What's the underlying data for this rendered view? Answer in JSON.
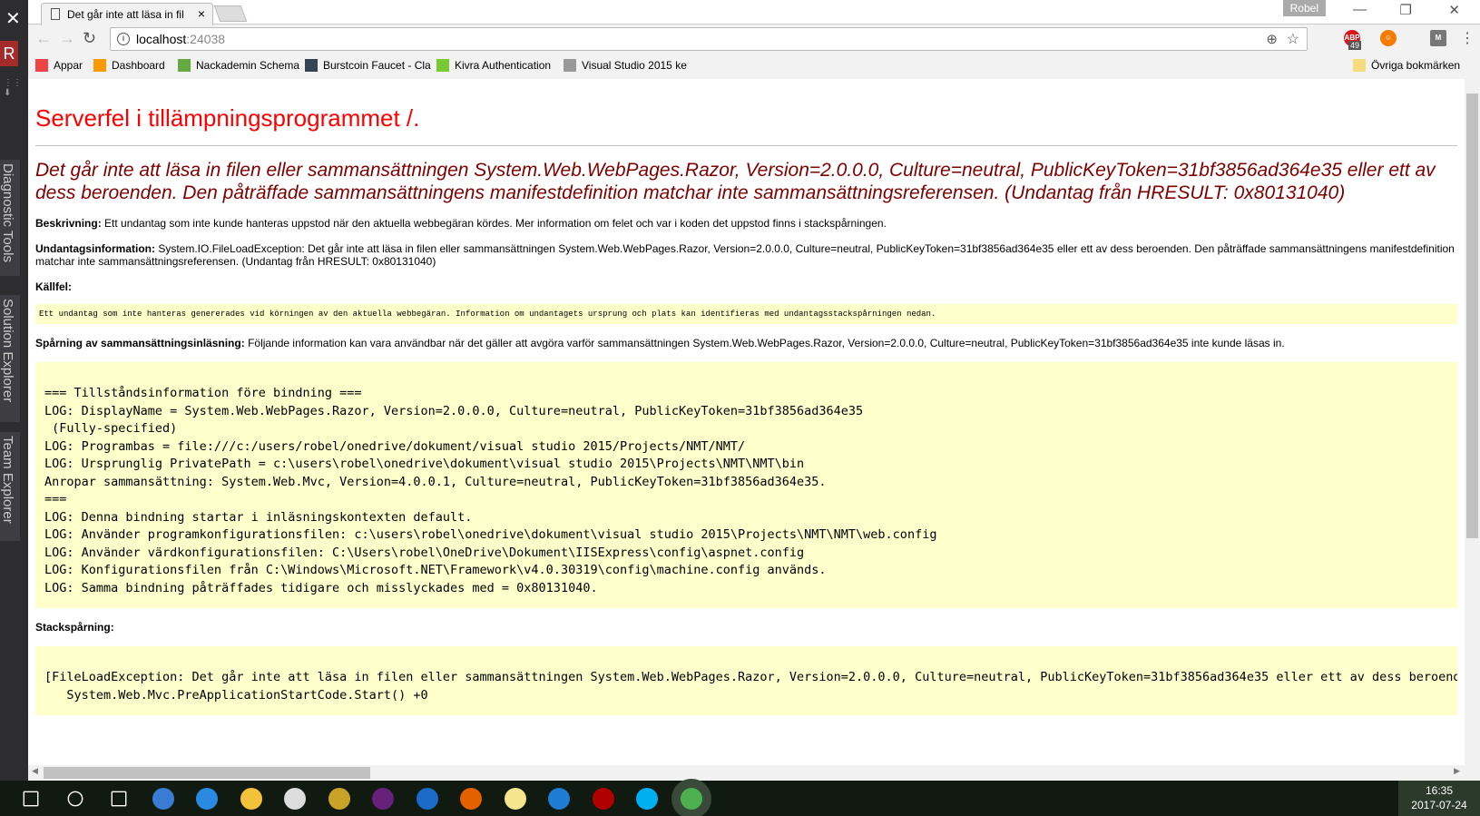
{
  "vs_sidebar": {
    "avatar_letter": "R",
    "panels": [
      "Diagnostic Tools",
      "Solution Explorer",
      "Team Explorer"
    ]
  },
  "browser": {
    "tab_title": "Det går inte att läsa in fil",
    "user": "Robel",
    "url_host": "localhost",
    "url_port": ":24038",
    "abp_badge": "49",
    "bookmarks": [
      {
        "label": "Appar",
        "icon": "apps-grid-icon",
        "color": "#e44"
      },
      {
        "label": "Dashboard",
        "icon": "moodle-icon",
        "color": "#f90"
      },
      {
        "label": "Nackademin Schema",
        "icon": "cupcake-icon",
        "color": "#6a4"
      },
      {
        "label": "Burstcoin Faucet - Cla",
        "icon": "burstcoin-icon",
        "color": "#345"
      },
      {
        "label": "Kivra Authentication",
        "icon": "kivra-icon",
        "color": "#7c3"
      },
      {
        "label": "Visual Studio 2015 ke",
        "icon": "document-icon",
        "color": "#999"
      }
    ],
    "other_bookmarks": "Övriga bokmärken"
  },
  "page": {
    "title": "Serverfel i tillämpningsprogrammet /.",
    "error_heading": "Det går inte att läsa in filen eller sammansättningen System.Web.WebPages.Razor, Version=2.0.0.0, Culture=neutral, PublicKeyToken=31bf3856ad364e35 eller ett av dess beroenden. Den påträffade sammansättningens manifestdefinition matchar inte sammansättningsreferensen. (Undantag från HRESULT: 0x80131040)",
    "description_label": "Beskrivning:",
    "description": "Ett undantag som inte kunde hanteras uppstod när den aktuella webbegäran kördes. Mer information om felet och var i koden det uppstod finns i stackspårningen.",
    "exception_label": "Undantagsinformation:",
    "exception": "System.IO.FileLoadException: Det går inte att läsa in filen eller sammansättningen System.Web.WebPages.Razor, Version=2.0.0.0, Culture=neutral, PublicKeyToken=31bf3856ad364e35 eller ett av dess beroenden. Den påträffade sammansättningens manifestdefinition matchar inte sammansättningsreferensen. (Undantag från HRESULT: 0x80131040)",
    "source_label": "Källfel:",
    "source_text": "Ett undantag som inte hanteras genererades vid körningen av den aktuella webbegäran. Information om undantagets ursprung och plats kan identifieras med undantagsstackspårningen nedan.",
    "trace_label": "Spårning av sammansättningsinläsning:",
    "trace_text": "Följande information kan vara användbar när det gäller att avgöra varför sammansättningen System.Web.WebPages.Razor, Version=2.0.0.0, Culture=neutral, PublicKeyToken=31bf3856ad364e35 inte kunde läsas in.",
    "log": "=== Tillståndsinformation före bindning ===\nLOG: DisplayName = System.Web.WebPages.Razor, Version=2.0.0.0, Culture=neutral, PublicKeyToken=31bf3856ad364e35\n (Fully-specified)\nLOG: Programbas = file:///c:/users/robel/onedrive/dokument/visual studio 2015/Projects/NMT/NMT/\nLOG: Ursprunglig PrivatePath = c:\\users\\robel\\onedrive\\dokument\\visual studio 2015\\Projects\\NMT\\NMT\\bin\nAnropar sammansättning: System.Web.Mvc, Version=4.0.0.1, Culture=neutral, PublicKeyToken=31bf3856ad364e35.\n===\nLOG: Denna bindning startar i inläsningskontexten default.\nLOG: Använder programkonfigurationsfilen: c:\\users\\robel\\onedrive\\dokument\\visual studio 2015\\Projects\\NMT\\NMT\\web.config\nLOG: Använder värdkonfigurationsfilen: C:\\Users\\robel\\OneDrive\\Dokument\\IISExpress\\config\\aspnet.config\nLOG: Konfigurationsfilen från C:\\Windows\\Microsoft.NET\\Framework\\v4.0.30319\\config\\machine.config används.\nLOG: Samma bindning påträffades tidigare och misslyckades med = 0x80131040.",
    "stack_label": "Stackspårning:",
    "stack": "[FileLoadException: Det går inte att läsa in filen eller sammansättningen System.Web.WebPages.Razor, Version=2.0.0.0, Culture=neutral, PublicKeyToken=31bf3856ad364e35 eller ett av dess beroenden. Den påträffade sammansättningens manifestdefinition matchar inte sammansättningsreferensen.\n   System.Web.Mvc.PreApplicationStartCode.Start() +0"
  },
  "taskbar": {
    "apps": [
      {
        "name": "start-icon",
        "color": "#fff"
      },
      {
        "name": "search-icon",
        "color": "#fff"
      },
      {
        "name": "task-view-icon",
        "color": "#fff"
      },
      {
        "name": "app-blue-icon",
        "color": "#3a7bd5"
      },
      {
        "name": "app-sync-icon",
        "color": "#2a8ae0"
      },
      {
        "name": "file-explorer-icon",
        "color": "#f3c13a"
      },
      {
        "name": "groove-icon",
        "color": "#ddd"
      },
      {
        "name": "tools-icon",
        "color": "#c9a227"
      },
      {
        "name": "visual-studio-icon",
        "color": "#68217a"
      },
      {
        "name": "bitcoin-app-icon",
        "color": "#1b6ac9"
      },
      {
        "name": "firefox-icon",
        "color": "#e66000"
      },
      {
        "name": "sticky-notes-icon",
        "color": "#f5e58c"
      },
      {
        "name": "edge-icon",
        "color": "#1e7bd4"
      },
      {
        "name": "filezilla-icon",
        "color": "#b20000"
      },
      {
        "name": "skype-icon",
        "color": "#00aff0"
      },
      {
        "name": "chrome-icon",
        "color": "#4caf50"
      }
    ],
    "time": "16:35",
    "date": "2017-07-24"
  }
}
